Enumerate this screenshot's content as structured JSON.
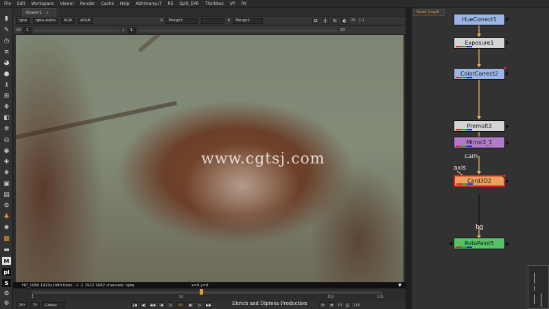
{
  "menu": [
    "File",
    "Edit",
    "Workspace",
    "Viewer",
    "Render",
    "Cache",
    "Help",
    "AbhimanyuT",
    "RS",
    "Split_EXR",
    "Thinkbox",
    "VP",
    "RV"
  ],
  "viewer": {
    "tab_label": "Viewer1",
    "tab_close": "x",
    "channels": "rgba",
    "alpha_channel": "rgba.alpha",
    "display_mode": "RGB",
    "colorspace": "sRGB",
    "input_a_label": "A",
    "input_a": "Merge3",
    "operation": "-",
    "input_b_label": "B",
    "input_b": "Merge3",
    "zoom_fps": "25",
    "proxy": "1:1",
    "view_mode": "2D",
    "fstop_label": "f/8",
    "gain": "1",
    "gamma_label": "y",
    "gamma": "1",
    "watermark": "www.cgtsj.com",
    "info_text": "HD_1080 1920x1080  bbox: -1 -1 1922 1082 channels: rgba",
    "coords": "x=0 y=0",
    "timeline_ticks": [
      "1",
      "50",
      "100",
      "116"
    ],
    "transport": {
      "fps": "25*",
      "tf": "TF",
      "scope": "Global",
      "current_frame": "50",
      "step": "10",
      "end_frame": "116"
    },
    "credit": "Ehrich   and   Diptesa  Production"
  },
  "node_graph": {
    "tab_label": "Node Graph",
    "nodes": [
      {
        "label": "HueCorrect1",
        "color": "#9ab5e6"
      },
      {
        "label": "Exposure1",
        "color": "#d4d4d4"
      },
      {
        "label": "ColorCorrect2",
        "color": "#9ab5e6"
      },
      {
        "label": "Premult3",
        "color": "#d4d4d4"
      },
      {
        "label": "Mirror2_1",
        "color": "#b07cc8"
      },
      {
        "label": "Card3D2",
        "color": "#e9a25f"
      },
      {
        "label": "RotoPaint5",
        "color": "#55c268"
      }
    ],
    "edge_labels": {
      "axis": "axis",
      "cam": "cam",
      "bg": "bg"
    }
  },
  "colors": {
    "accent": "#e59a2e",
    "edge": "#e8b46a",
    "selected": "#e02020"
  }
}
